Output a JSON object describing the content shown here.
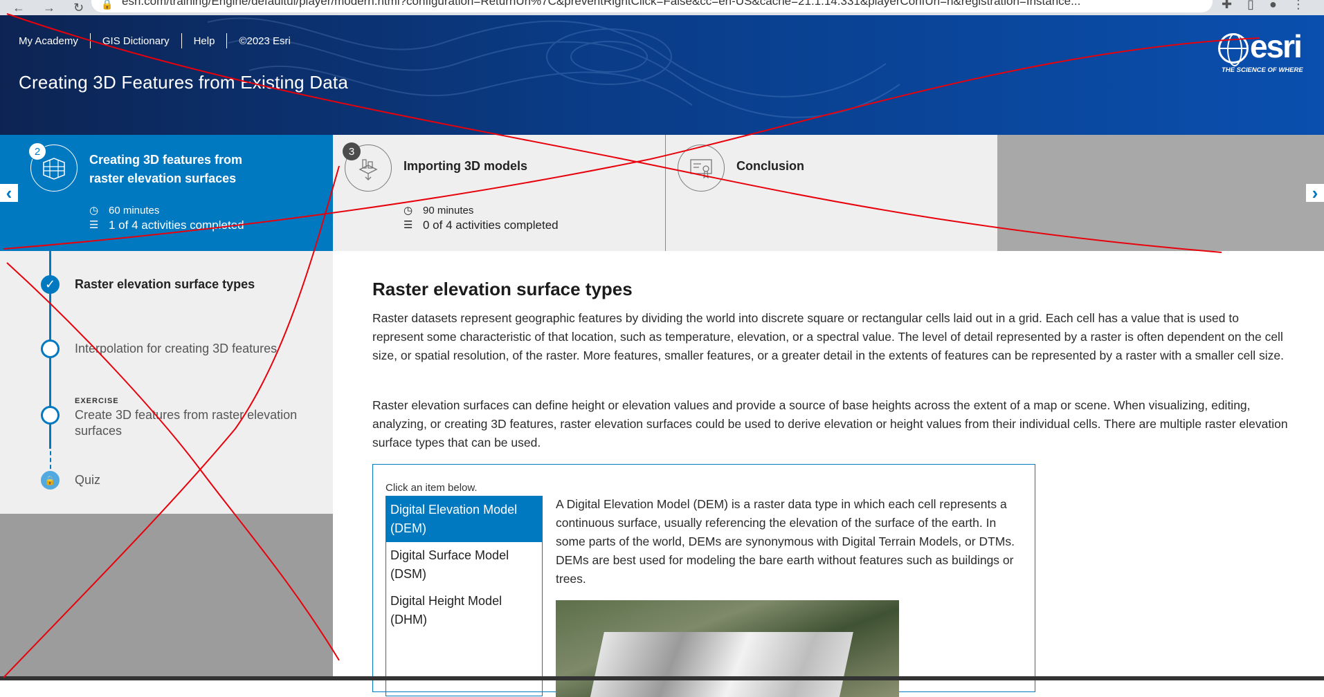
{
  "browser": {
    "url": "esri.com/training/Engine/defaultui/player/modern.html?configuration=ReturnUrl%7C&preventRightClick=False&cc=en-US&cache=21.1.14.331&playerConfUrl=h&registration=Instance..."
  },
  "header": {
    "links": [
      "My Academy",
      "GIS Dictionary",
      "Help",
      "©2023 Esri"
    ],
    "course_title": "Creating 3D Features from Existing Data",
    "logo_word": "esri",
    "logo_tagline": "THE SCIENCE OF WHERE"
  },
  "carousel": {
    "prev_label": "‹",
    "next_label": "›",
    "lessons": [
      {
        "number": "2",
        "title": "Creating 3D features from raster elevation surfaces",
        "duration": "60 minutes",
        "progress": "1 of 4 activities completed"
      },
      {
        "number": "3",
        "title": "Importing 3D models",
        "duration": "90 minutes",
        "progress": "0 of 4 activities completed"
      },
      {
        "number": "",
        "title": "Conclusion",
        "duration": "",
        "progress": ""
      }
    ]
  },
  "sidenav": {
    "steps": [
      {
        "kicker": "",
        "label": "Raster elevation surface types",
        "state": "completed"
      },
      {
        "kicker": "",
        "label": "Interpolation for creating 3D features",
        "state": "open"
      },
      {
        "kicker": "EXERCISE",
        "label": "Create 3D features from raster elevation surfaces",
        "state": "open"
      },
      {
        "kicker": "",
        "label": "Quiz",
        "state": "locked"
      }
    ]
  },
  "content": {
    "title": "Raster elevation surface types",
    "paragraphs": [
      "Raster datasets represent geographic features by dividing the world into discrete square or rectangular cells laid out in a grid. Each cell has a value that is used to represent some characteristic of that location, such as temperature, elevation, or a spectral value. The level of detail represented by a raster is often dependent on the cell size, or spatial resolution, of the raster. More features, smaller features, or a greater detail in the extents of features can be represented by a raster with a smaller cell size.",
      "Raster elevation surfaces can define height or elevation values and provide a source of base heights across the extent of a map or scene. When visualizing, editing, analyzing, or creating 3D features, raster elevation surfaces could be used to derive elevation or height values from their individual cells. There are multiple raster elevation surface types that can be used."
    ],
    "widget": {
      "hint": "Click an item below.",
      "items": [
        "Digital Elevation Model (DEM)",
        "Digital Surface Model (DSM)",
        "Digital Height Model (DHM)"
      ],
      "selected_index": 0,
      "description": "A Digital Elevation Model (DEM) is a raster data type in which each cell represents a continuous surface, usually referencing the elevation of the surface of the earth. In some parts of the world, DEMs are synonymous with Digital Terrain Models, or DTMs. DEMs are best used for modeling the bare earth without features such as buildings or trees."
    }
  },
  "colors": {
    "accent": "#0079c1",
    "banner_dark": "#0d2453",
    "annotation": "#e8000b"
  }
}
